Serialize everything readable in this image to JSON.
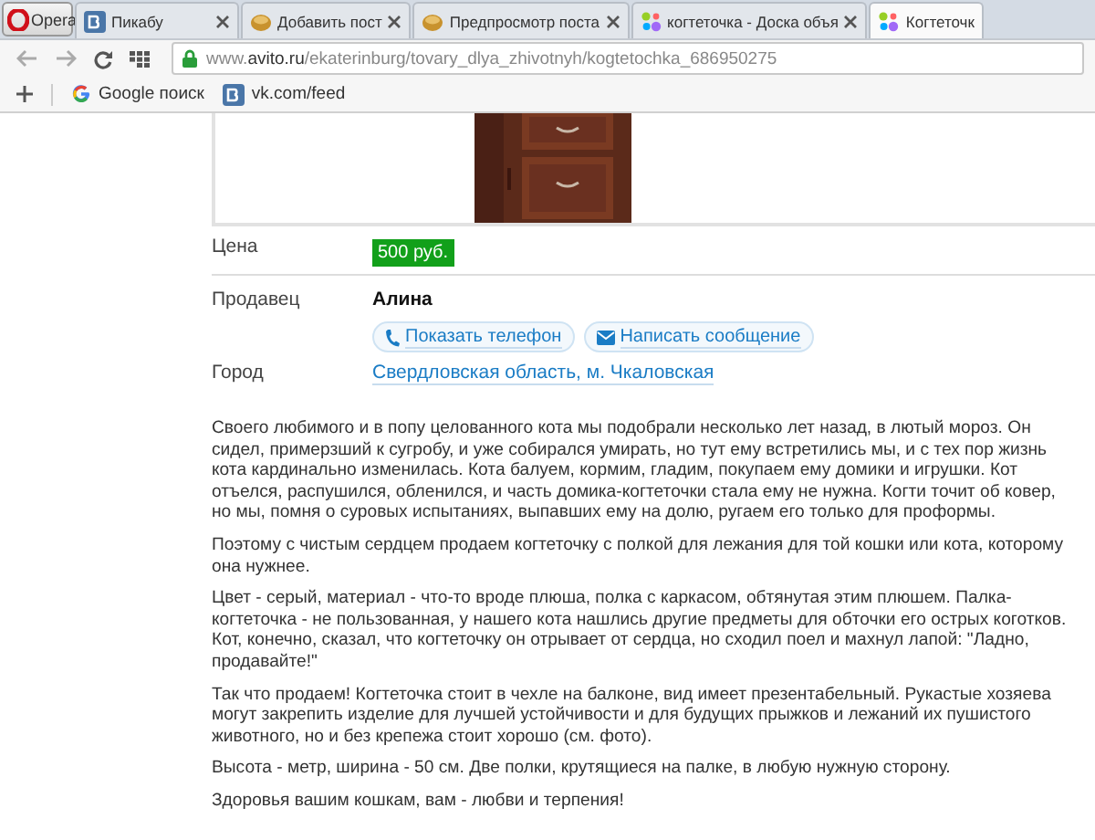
{
  "browser": {
    "menu_label": "Opera",
    "tabs": [
      {
        "label": "Пикабу",
        "kind": "vk",
        "selected": false
      },
      {
        "label": "Добавить пост",
        "kind": "cookie",
        "selected": false
      },
      {
        "label": "Предпросмотр поста",
        "kind": "cookie",
        "selected": false
      },
      {
        "label": "когтеточка - Доска объя",
        "kind": "dots",
        "selected": false
      },
      {
        "label": "Когтеточк",
        "kind": "dots",
        "selected": true
      }
    ],
    "address": {
      "prefix": "www.",
      "domain": "avito.ru",
      "path": "/ekaterinburg/tovary_dlya_zhivotnyh/kogtetochka_686950275"
    },
    "bookmarks": [
      {
        "label": "Google поиск",
        "kind": "google"
      },
      {
        "label": "vk.com/feed",
        "kind": "vk"
      }
    ]
  },
  "listing": {
    "price_label": "Цена",
    "price": "500 руб.",
    "seller_label": "Продавец",
    "seller_name": "Алина",
    "buttons": [
      {
        "label": "Показать телефон",
        "kind": "phone"
      },
      {
        "label": "Написать сообщение",
        "kind": "mail"
      }
    ],
    "city_label": "Город",
    "city": "Свердловская область, м. Чкаловская",
    "description": [
      "Своего любимого и в попу целованного кота мы подобрали несколько лет назад, в лютый мороз. Он сидел, примерзший к сугробу, и уже собирался умирать, но тут ему встретились мы, и с тех пор жизнь кота кардинально изменилась. Кота балуем, кормим, гладим, покупаем ему домики и игрушки. Кот отъелся, распушился, обленился, и часть домика-когтеточки стала ему не нужна. Когти точит об ковер, но мы, помня о суровых испытаниях, выпавших ему на долю, ругаем его только для проформы.",
      "Поэтому с чистым сердцем продаем когтеточку с полкой для лежания для той кошки или кота, которому она нужнее.",
      "Цвет - серый, материал - что-то вроде плюша, полка с каркасом, обтянутая этим плюшем. Палка-когтеточка - не пользованная, у нашего кота нашлись другие предметы для обточки его острых коготков. Кот, конечно, сказал, что когтеточку он отрывает от сердца, но сходил поел и махнул лапой: \"Ладно, продавайте!\"",
      "Так что продаем! Когтеточка стоит в чехле на балконе, вид имеет презентабельный. Рукастые хозяева могут закрепить изделие для лучшей устойчивости и для будущих прыжков и лежаний их пушистого животного, но и без крепежа стоит хорошо (см. фото).",
      "Высота - метр, ширина - 50 см. Две полки, крутящиеся на палке, в любую нужную сторону.",
      "Здоровья вашим кошкам, вам - любви и терпения!"
    ]
  }
}
